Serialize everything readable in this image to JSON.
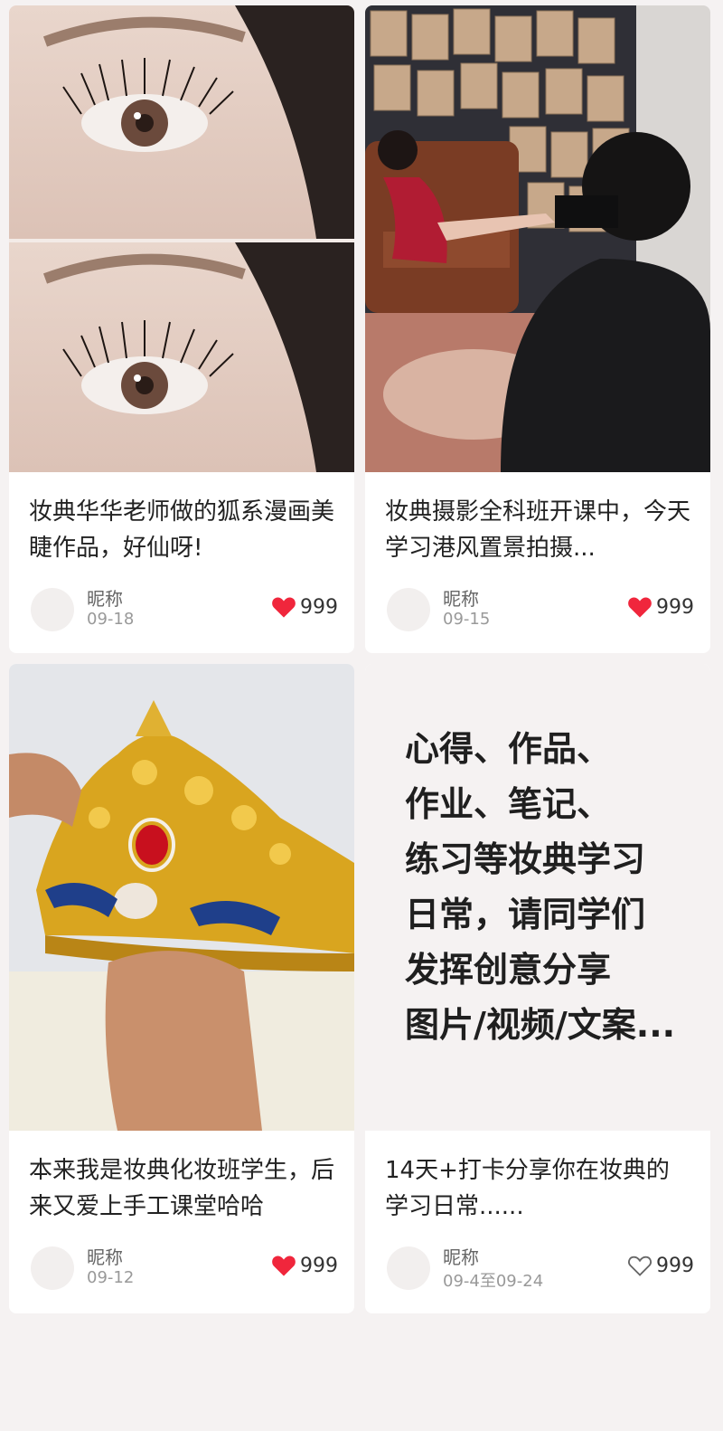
{
  "colors": {
    "heart_filled": "#f0263c",
    "heart_outline": "#666666",
    "page_bg": "#f5f2f2"
  },
  "cards": [
    {
      "image_alt": "狐系漫画美睫 eyelash close-up before/after",
      "caption": "妆典华华老师做的狐系漫画美睫作品，好仙呀!",
      "nickname": "昵称",
      "date": "09-18",
      "likes": "999",
      "liked": true
    },
    {
      "image_alt": "港风置景拍摄 photo shoot",
      "caption": "妆典摄影全科班开课中，今天学习港风置景拍摄...",
      "nickname": "昵称",
      "date": "09-15",
      "likes": "999",
      "liked": true
    },
    {
      "image_alt": "handmade golden crown",
      "caption": "本来我是妆典化妆班学生，后来又爱上手工课堂哈哈",
      "nickname": "昵称",
      "date": "09-12",
      "likes": "999",
      "liked": true
    },
    {
      "promo_lines": [
        "心得、作品、",
        "作业、笔记、",
        "练习等妆典学习",
        "日常，请同学们",
        "发挥创意分享",
        "图片/视频/文案..."
      ],
      "caption": "14天+打卡分享你在妆典的学习日常......",
      "nickname": "昵称",
      "date": "09-4至09-24",
      "likes": "999",
      "liked": false
    }
  ]
}
